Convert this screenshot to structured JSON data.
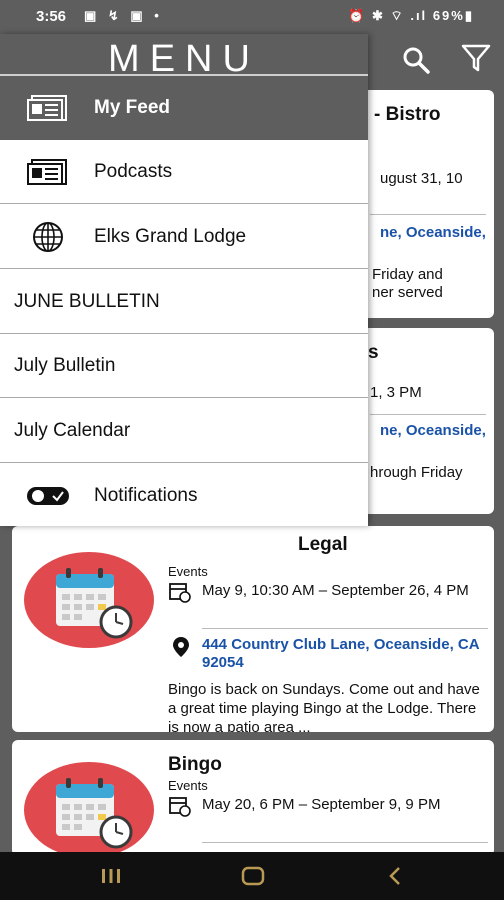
{
  "status": {
    "time": "3:56",
    "notif_icons": "▣ ↯ ▣ •",
    "sys_icons": "⏰ ✱ ⌔ .ıl",
    "battery": "69%"
  },
  "menu": {
    "title": "MENU",
    "items": [
      {
        "label": "My Feed",
        "icon": "newspaper-icon",
        "active": true
      },
      {
        "label": "Podcasts",
        "icon": "newspaper-icon"
      },
      {
        "label": "Elks Grand Lodge",
        "icon": "globe-icon"
      },
      {
        "label": "JUNE BULLETIN"
      },
      {
        "label": "July Bulletin"
      },
      {
        "label": "July Calendar"
      },
      {
        "label": "Notifications",
        "icon": "toggle-icon"
      }
    ]
  },
  "cards": {
    "c1": {
      "title": "- Bistro",
      "date": "ugust 31, 10",
      "location": "ne, Oceanside,",
      "desc1": "Friday and",
      "desc2": "ner served"
    },
    "c2": {
      "title": "s",
      "date": "1, 3 PM",
      "location": "ne, Oceanside,",
      "desc1": "hrough Friday"
    },
    "c3": {
      "title": "Legal",
      "category": "Events",
      "date": "May 9, 10:30 AM – September 26, 4 PM",
      "location": "444 Country Club Lane, Oceanside, CA 92054",
      "desc": "Bingo is back on Sundays. Come out and have a great time playing Bingo at the Lodge. There is now a patio area ..."
    },
    "c4": {
      "title": "Bingo",
      "category": "Events",
      "date": "May 20, 6 PM – September 9, 9 PM"
    }
  },
  "colors": {
    "header": "#5e5e5e",
    "link": "#1a52a8",
    "thumb": "#e04a4f",
    "navbar": "#101010"
  }
}
